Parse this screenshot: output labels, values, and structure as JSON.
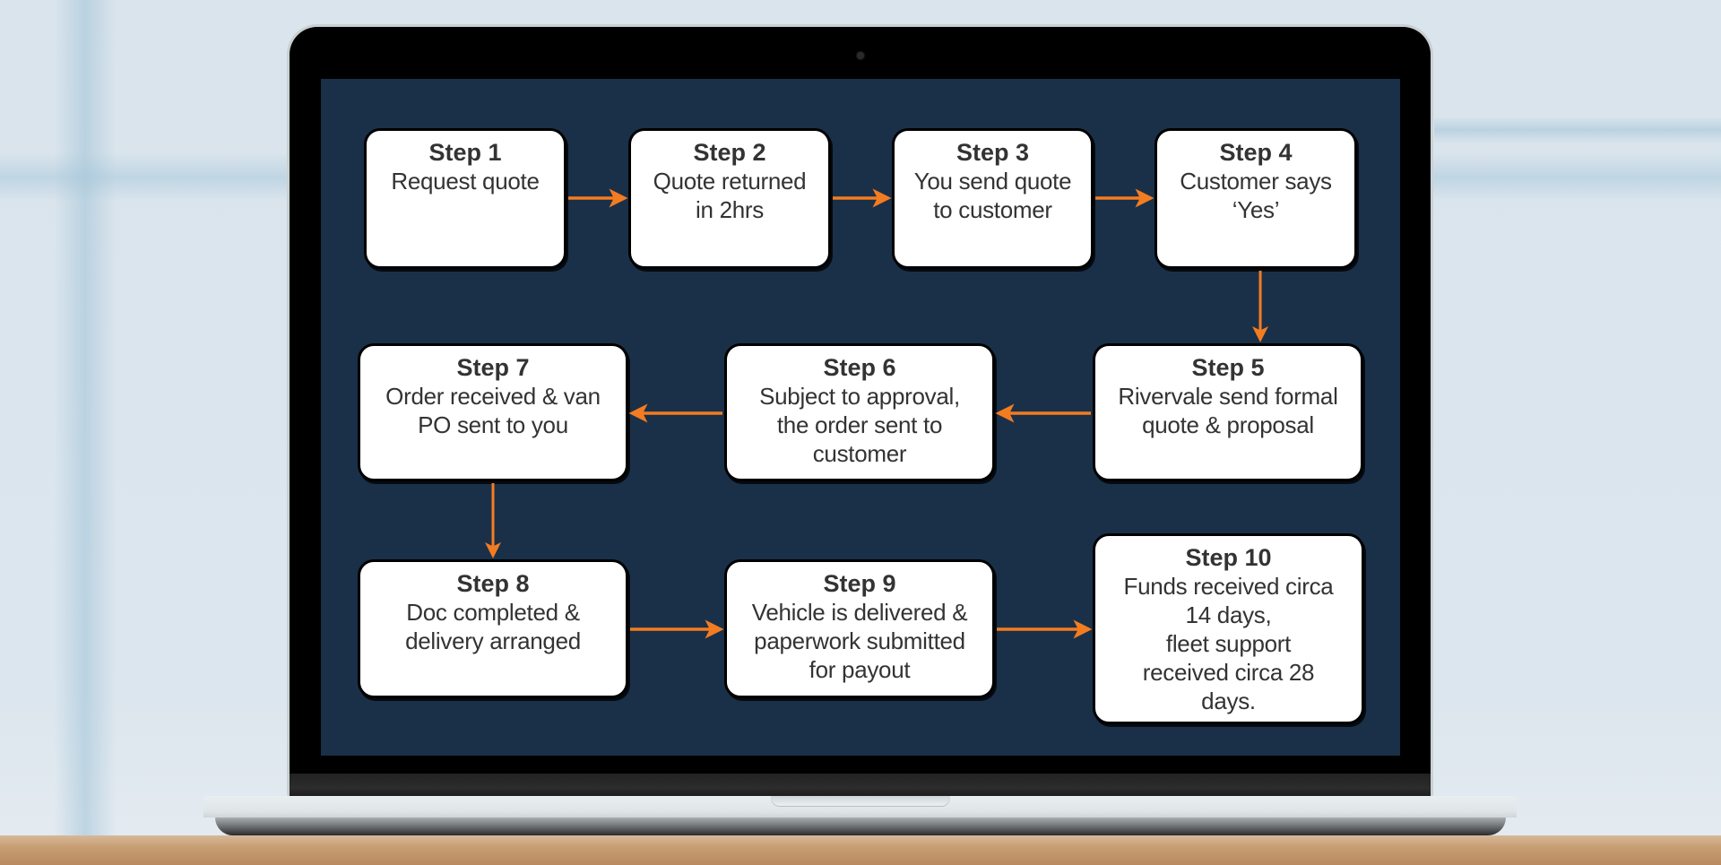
{
  "colors": {
    "screen_bg": "#1a3048",
    "box_bg": "#ffffff",
    "box_border": "#000000",
    "arrow": "#f47c20",
    "text": "#333333"
  },
  "steps": [
    {
      "title": "Step 1",
      "lines": [
        "Request quote"
      ]
    },
    {
      "title": "Step 2",
      "lines": [
        "Quote returned",
        "in 2hrs"
      ]
    },
    {
      "title": "Step 3",
      "lines": [
        "You send quote",
        "to customer"
      ]
    },
    {
      "title": "Step 4",
      "lines": [
        "Customer says",
        "‘Yes’"
      ]
    },
    {
      "title": "Step 5",
      "lines": [
        "Rivervale send formal",
        "quote & proposal"
      ]
    },
    {
      "title": "Step 6",
      "lines": [
        "Subject to approval,",
        "the order sent to",
        "customer"
      ]
    },
    {
      "title": "Step 7",
      "lines": [
        "Order received & van",
        "PO sent to you"
      ]
    },
    {
      "title": "Step 8",
      "lines": [
        "Doc completed &",
        "delivery arranged"
      ]
    },
    {
      "title": "Step 9",
      "lines": [
        "Vehicle is delivered &",
        "paperwork submitted",
        "for payout"
      ]
    },
    {
      "title": "Step 10",
      "lines": [
        "Funds received circa",
        "14 days,",
        "fleet support",
        "received circa 28",
        "days."
      ]
    }
  ],
  "connections": [
    {
      "from": "Step 1",
      "to": "Step 2",
      "direction": "right"
    },
    {
      "from": "Step 2",
      "to": "Step 3",
      "direction": "right"
    },
    {
      "from": "Step 3",
      "to": "Step 4",
      "direction": "right"
    },
    {
      "from": "Step 4",
      "to": "Step 5",
      "direction": "down"
    },
    {
      "from": "Step 5",
      "to": "Step 6",
      "direction": "left"
    },
    {
      "from": "Step 6",
      "to": "Step 7",
      "direction": "left"
    },
    {
      "from": "Step 7",
      "to": "Step 8",
      "direction": "down"
    },
    {
      "from": "Step 8",
      "to": "Step 9",
      "direction": "right"
    },
    {
      "from": "Step 9",
      "to": "Step 10",
      "direction": "right"
    }
  ]
}
